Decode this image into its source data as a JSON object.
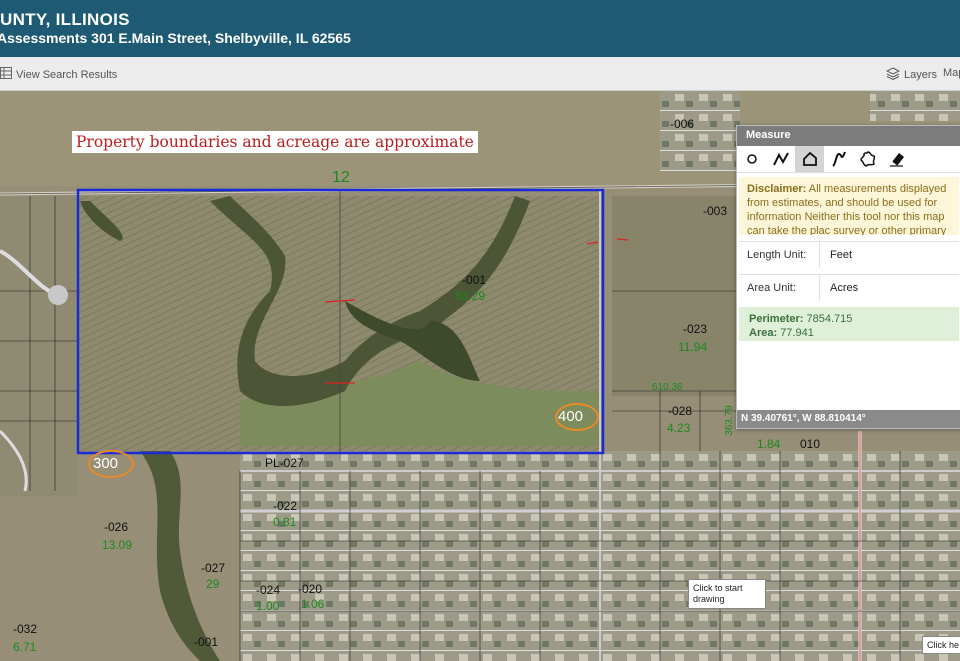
{
  "header": {
    "title": "UNTY, ILLINOIS",
    "subtitle": "Assessments 301 E.Main Street, Shelbyville, IL 62565"
  },
  "toolbar": {
    "view_search_results": "View Search Results",
    "layers": "Layers",
    "maps": "Map",
    "icons": {
      "results": "table-grid-icon",
      "layers": "layers-stack-icon"
    }
  },
  "map": {
    "notice": "Property boundaries and acreage are approximate",
    "road_label": "12",
    "parcels": [
      {
        "id": "-001",
        "acres": "83.29"
      },
      {
        "id": "-003",
        "acres": ""
      },
      {
        "id": "-006",
        "acres": ""
      },
      {
        "id": "-023",
        "acres": "11.94"
      },
      {
        "id": "-028",
        "acres": "4.23"
      },
      {
        "id": "-026",
        "acres": "13.09"
      },
      {
        "id": "-027",
        "acres": "29"
      },
      {
        "id": "-024",
        "acres": "1.00"
      },
      {
        "id": "-020",
        "acres": "1.06"
      },
      {
        "id": "-022",
        "acres": "0.81"
      },
      {
        "id": "-032",
        "acres": "6.71"
      },
      {
        "id": "-001",
        "acres": ""
      },
      {
        "id": "PL-027",
        "acres": ""
      },
      {
        "id": "010",
        "acres": "1.84"
      }
    ],
    "sections": [
      "400",
      "300"
    ],
    "dimension": "610.36",
    "dimension_vertical": "363.79",
    "colors": {
      "boundary": "#1a2bd6",
      "section_circle": "#e98a25",
      "acre_text": "#1d8a1d"
    }
  },
  "measure": {
    "title": "Measure",
    "tools": [
      "circle-icon",
      "polyline-icon",
      "polygon-icon",
      "freehand-line-icon",
      "freehand-polygon-icon",
      "eraser-icon"
    ],
    "disclaimer_label": "Disclaimer:",
    "disclaimer_text": "All measurements displayed from estimates, and should be used for information Neither this tool nor this map can take the plac survey or other primary source documentation",
    "length_unit_label": "Length Unit:",
    "length_unit_value": "Feet",
    "area_unit_label": "Area Unit:",
    "area_unit_value": "Acres",
    "perimeter_label": "Perimeter:",
    "perimeter_value": "7854.715",
    "area_label": "Area:",
    "area_value": "77.941",
    "coordinates": "N 39.40761°, W 88.810414°"
  },
  "tooltips": {
    "start_drawing": "Click to start drawing",
    "click_here": "Click he"
  }
}
